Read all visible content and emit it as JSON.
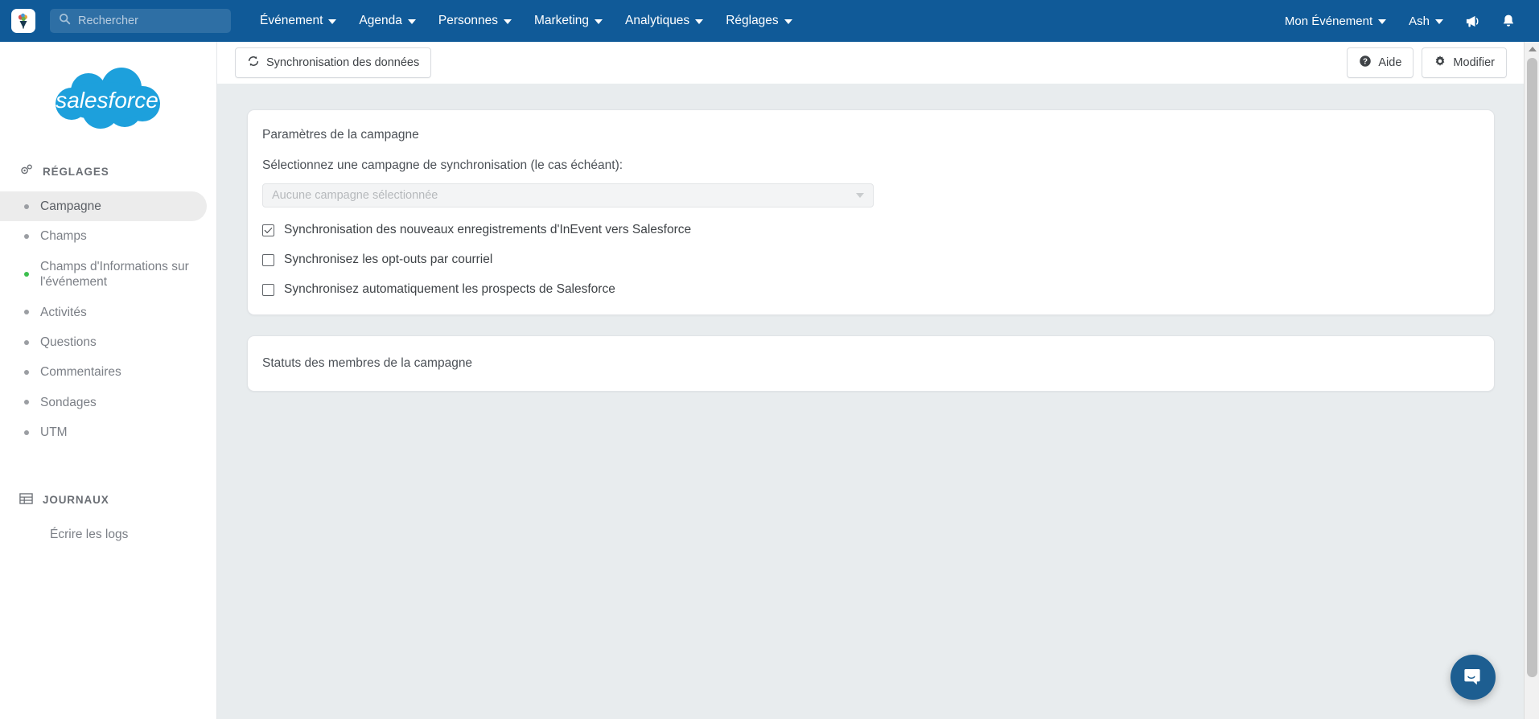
{
  "topnav": {
    "app_logo": "inevent-logo-icon",
    "search": {
      "placeholder": "Rechercher",
      "value": "",
      "icon": "search-icon"
    },
    "menu": [
      {
        "label": "Événement"
      },
      {
        "label": "Agenda"
      },
      {
        "label": "Personnes"
      },
      {
        "label": "Marketing"
      },
      {
        "label": "Analytiques"
      },
      {
        "label": "Réglages"
      }
    ],
    "right": {
      "event_selector": "Mon Événement",
      "user": "Ash",
      "announcement_icon": "megaphone-icon",
      "notification_icon": "bell-icon"
    }
  },
  "sidebar": {
    "logo": "salesforce-logo",
    "sections": [
      {
        "title": "RÉGLAGES",
        "icon": "gears-icon",
        "items": [
          {
            "label": "Campagne",
            "bullet": "gray",
            "active": true
          },
          {
            "label": "Champs",
            "bullet": "gray",
            "active": false
          },
          {
            "label": "Champs d'Informations sur l'événement",
            "bullet": "green",
            "active": false
          },
          {
            "label": "Activités",
            "bullet": "gray",
            "active": false
          },
          {
            "label": "Questions",
            "bullet": "gray",
            "active": false
          },
          {
            "label": "Commentaires",
            "bullet": "gray",
            "active": false
          },
          {
            "label": "Sondages",
            "bullet": "gray",
            "active": false
          },
          {
            "label": "UTM",
            "bullet": "gray",
            "active": false
          }
        ]
      },
      {
        "title": "JOURNAUX",
        "icon": "table-icon",
        "items": [
          {
            "label": "Écrire les logs",
            "bullet": "none",
            "active": false
          }
        ]
      }
    ]
  },
  "toolbar": {
    "sync_label": "Synchronisation des données",
    "sync_icon": "refresh-icon",
    "help_label": "Aide",
    "help_icon": "question-circle-icon",
    "edit_label": "Modifier",
    "edit_icon": "gear-icon"
  },
  "main": {
    "campaign_card": {
      "title": "Paramètres de la campagne",
      "select_label": "Sélectionnez une campagne de synchronisation (le cas échéant):",
      "select_value": "Aucune campagne sélectionnée",
      "checkboxes": [
        {
          "label": "Synchronisation des nouveaux enregistrements d'InEvent vers Salesforce",
          "checked": true
        },
        {
          "label": "Synchronisez les opt-outs par courriel",
          "checked": false
        },
        {
          "label": "Synchronisez automatiquement les prospects de Salesforce",
          "checked": false
        }
      ]
    },
    "status_card": {
      "title": "Statuts des membres de la campagne"
    }
  },
  "chat": {
    "icon": "chat-bubble-icon"
  },
  "colors": {
    "nav_blue": "#105a98",
    "canvas_bg": "#e8ecee",
    "accent_green": "#3dbf4e",
    "salesforce_blue": "#1da0dc",
    "chat_blue": "#1d5e91"
  }
}
